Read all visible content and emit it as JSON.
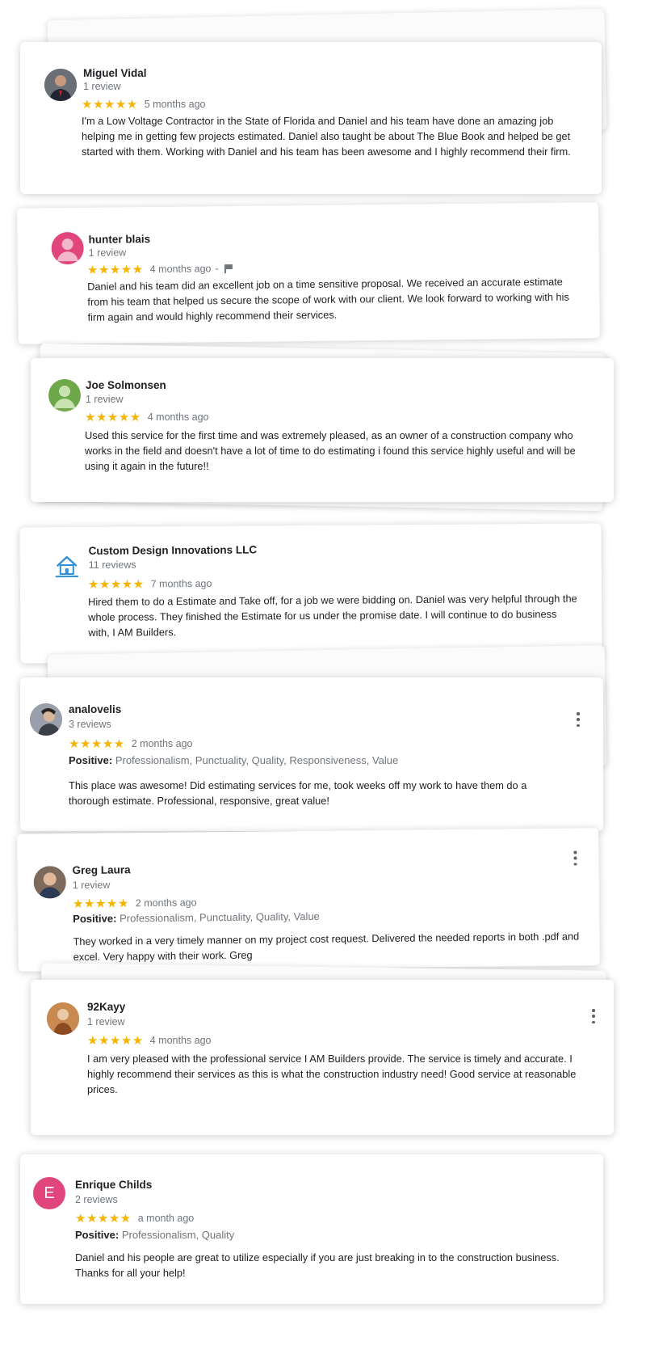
{
  "stars_glyph": "★★★★★",
  "reviews": [
    {
      "name": "Miguel Vidal",
      "count": "1 review",
      "date": "5 months ago",
      "text": "I'm a Low Voltage Contractor in the State of Florida and Daniel and his team have done an amazing job helping me in getting few projects estimated. Daniel also taught be about The Blue Book and helped be get started with them. Working with Daniel and his team has been awesome and I highly recommend their firm."
    },
    {
      "name": "hunter blais",
      "count": "1 review",
      "date": "4 months ago",
      "separator": "-",
      "text": "Daniel and his team did an excellent job on a time sensitive proposal. We received an accurate estimate from his team that helped us secure the scope of work with our client. We look forward to working with his firm again and would highly recommend their services."
    },
    {
      "name": "Joe Solmonsen",
      "count": "1 review",
      "date": "4 months ago",
      "text": "Used this service for the first time and was extremely pleased, as an owner of a construction company who works in the field and doesn't have a lot of time to do estimating i found this service highly useful and will be using it again in the future!!"
    },
    {
      "name": "Custom Design Innovations LLC",
      "count": "11 reviews",
      "date": "7 months ago",
      "text": "Hired them to do a Estimate and Take off, for a job we were bidding on. Daniel was very helpful through the whole process.  They finished the Estimate for us under the promise date. I will continue to do business with, I AM Builders."
    },
    {
      "name": "analovelis",
      "count": "3 reviews",
      "date": "2 months ago",
      "positive_label": "Positive:",
      "positive_values": "Professionalism, Punctuality, Quality, Responsiveness, Value",
      "text": "This place was awesome! Did estimating services for me, took weeks off my work to have them do a thorough estimate. Professional, responsive, great value!"
    },
    {
      "name": "Greg Laura",
      "count": "1 review",
      "date": "2 months ago",
      "positive_label": "Positive:",
      "positive_values": "Professionalism, Punctuality, Quality, Value",
      "text": "They worked in a very timely manner on my project cost request. Delivered the needed reports in both .pdf and excel. Very happy with their work.  Greg"
    },
    {
      "name": "92Kayy",
      "count": "1 review",
      "date": "4 months ago",
      "text": "I am very pleased with the professional service I AM Builders provide.  The service is timely and accurate.  I highly recommend their services as this is what the construction industry need!  Good service at reasonable prices."
    },
    {
      "name": "Enrique Childs",
      "count": "2 reviews",
      "date": "a month ago",
      "avatar_letter": "E",
      "positive_label": "Positive:",
      "positive_values": "Professionalism, Quality",
      "text": "Daniel and his people are great to utilize especially if you are just breaking in to the construction business.  Thanks for all your help!"
    }
  ],
  "colors": {
    "star": "#f5b400",
    "avatar_hunter": "#e0457b",
    "avatar_joe": "#6ea84a",
    "avatar_enrique": "#e0457b"
  },
  "icons": [
    "flag-icon",
    "more-vert-icon",
    "house-logo-icon",
    "default-person-icon"
  ]
}
